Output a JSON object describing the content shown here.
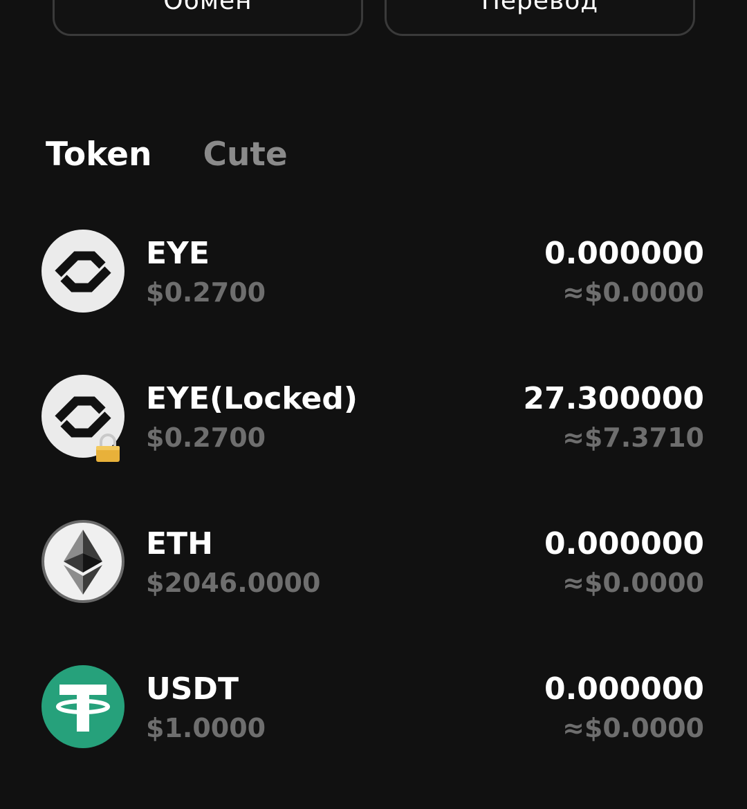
{
  "actions": {
    "exchange_label": "Обмен",
    "transfer_label": "Перевод"
  },
  "tabs": [
    {
      "label": "Token",
      "active": true
    },
    {
      "label": "Cute",
      "active": false
    }
  ],
  "tokens": [
    {
      "name": "EYE",
      "price": "$0.2700",
      "amount": "0.000000",
      "value": "≈$0.0000",
      "icon": "eye-token-icon"
    },
    {
      "name": "EYE(Locked)",
      "price": "$0.2700",
      "amount": "27.300000",
      "value": "≈$7.3710",
      "icon": "eye-token-icon",
      "badge": "lock-icon"
    },
    {
      "name": "ETH",
      "price": "$2046.0000",
      "amount": "0.000000",
      "value": "≈$0.0000",
      "icon": "ethereum-icon"
    },
    {
      "name": "USDT",
      "price": "$1.0000",
      "amount": "0.000000",
      "value": "≈$0.0000",
      "icon": "tether-icon"
    }
  ],
  "colors": {
    "background": "#111111",
    "text_primary": "#ffffff",
    "text_secondary": "#6e6e6e",
    "tab_inactive": "#8a8a8a",
    "tether_green": "#26a17b",
    "lock_gold": "#e8b13a"
  }
}
